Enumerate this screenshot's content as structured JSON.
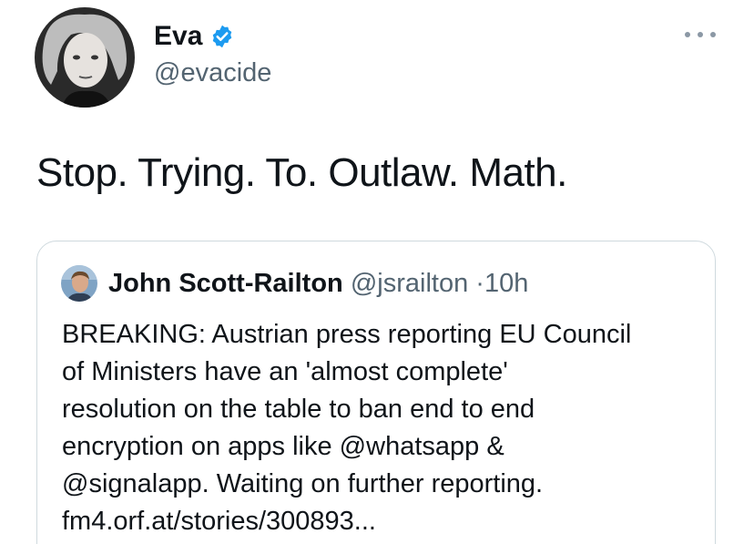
{
  "tweet": {
    "author": {
      "display_name": "Eva",
      "handle": "@evacide",
      "verified": true,
      "avatar_icon": "profile-photo-woman",
      "verified_icon": "verified-badge-icon"
    },
    "more_icon": "more-options-icon",
    "text": "Stop. Trying. To. Outlaw. Math."
  },
  "quoted_tweet": {
    "author": {
      "display_name": "John Scott-Railton",
      "handle": "@jsrailton",
      "avatar_icon": "profile-photo-man"
    },
    "separator": "·",
    "time": "10h",
    "text_lines": [
      "BREAKING: Austrian press reporting EU Council",
      "of Ministers have an 'almost complete'",
      "resolution on the table to ban end to end",
      "encryption on apps like @whatsapp &",
      "@signalapp.  Waiting on further reporting.",
      "fm4.orf.at/stories/300893..."
    ]
  },
  "colors": {
    "text": "#0f1419",
    "secondary": "#536471",
    "border": "#cfd9de",
    "verified_blue": "#1d9bf0"
  }
}
